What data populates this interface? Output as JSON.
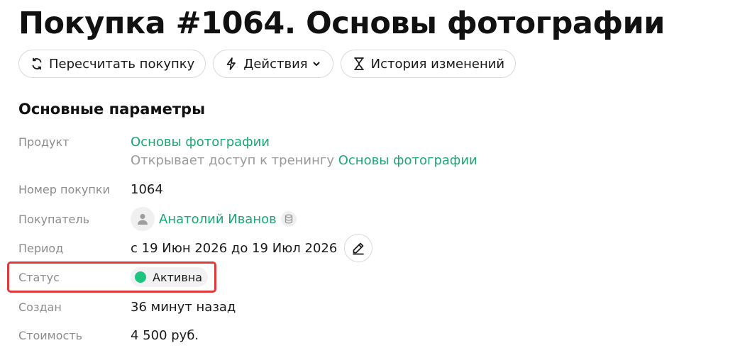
{
  "page": {
    "title": "Покупка #1064. Основы фотографии"
  },
  "toolbar": {
    "recalc_label": "Пересчитать покупку",
    "recalc_icon": "refresh-icon",
    "actions_label": "Действия",
    "actions_icon": "lightning-icon",
    "history_label": "История изменений",
    "history_icon": "hourglass-icon"
  },
  "section": {
    "title": "Основные параметры"
  },
  "fields": {
    "product": {
      "label": "Продукт",
      "value": "Основы фотографии",
      "note_prefix": "Открывает доступ к тренингу",
      "note_link": "Основы фотографии"
    },
    "number": {
      "label": "Номер покупки",
      "value": "1064"
    },
    "buyer": {
      "label": "Покупатель",
      "value": "Анатолий Иванов"
    },
    "period": {
      "label": "Период",
      "value": "с 19 Июн 2026 до 19 Июл 2026"
    },
    "status": {
      "label": "Статус",
      "value": "Активна",
      "color": "#1fc47f"
    },
    "created": {
      "label": "Создан",
      "value": "36 минут назад"
    },
    "price": {
      "label": "Стоимость",
      "value": "4 500 руб."
    }
  },
  "colors": {
    "link": "#1aa874",
    "highlight": "#e0393b"
  }
}
